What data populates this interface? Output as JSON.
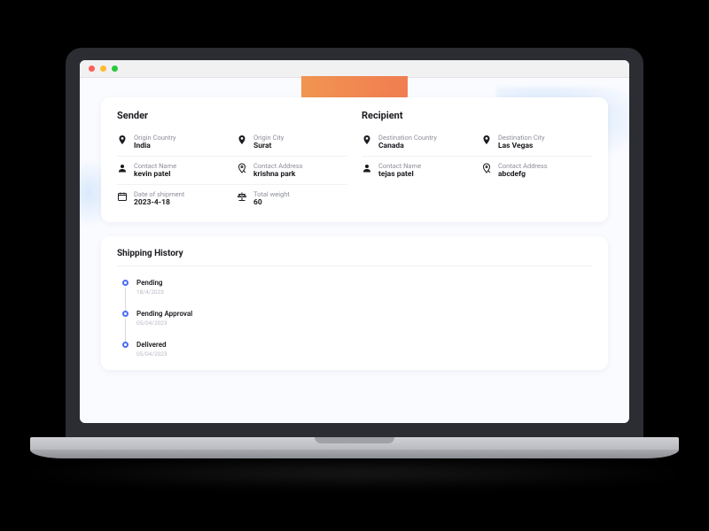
{
  "sender": {
    "title": "Sender",
    "origin_country": {
      "label": "Origin Country",
      "value": "India"
    },
    "origin_city": {
      "label": "Origin City",
      "value": "Surat"
    },
    "contact_name": {
      "label": "Contact Name",
      "value": "kevin patel"
    },
    "contact_address": {
      "label": "Contact Address",
      "value": "krishna park"
    },
    "date_of_shipment": {
      "label": "Date of shipment",
      "value": "2023-4-18"
    },
    "total_weight": {
      "label": "Total weight",
      "value": "60"
    }
  },
  "recipient": {
    "title": "Recipient",
    "dest_country": {
      "label": "Destination Country",
      "value": "Canada"
    },
    "dest_city": {
      "label": "Destination City",
      "value": "Las Vegas"
    },
    "contact_name": {
      "label": "Contact Name",
      "value": "tejas patel"
    },
    "contact_address": {
      "label": "Contact Address",
      "value": "abcdefg"
    }
  },
  "history": {
    "title": "Shipping History",
    "items": [
      {
        "label": "Pending",
        "date": "18/4/2023"
      },
      {
        "label": "Pending Approval",
        "date": "05/04/2023"
      },
      {
        "label": "Delivered",
        "date": "05/04/2023"
      }
    ]
  }
}
